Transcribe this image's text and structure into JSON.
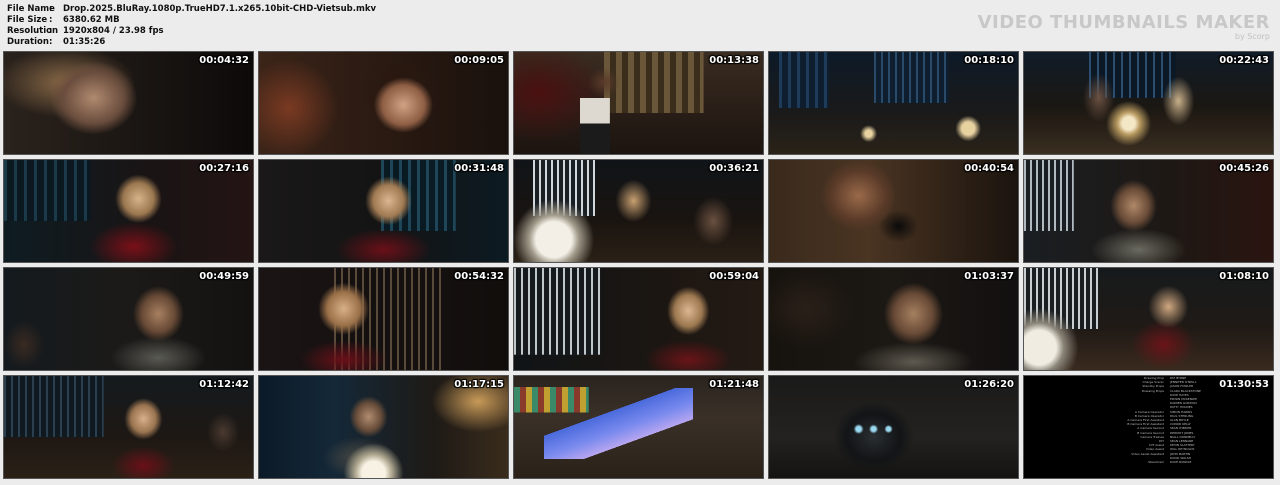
{
  "file_info": [
    {
      "key": "File Name",
      "value": "Drop.2025.BluRay.1080p.TrueHD7.1.x265.10bit-CHD-Vietsub.mkv"
    },
    {
      "key": "File Size",
      "value": "6380.62 MB"
    },
    {
      "key": "Resolution",
      "value": "1920x804 / 23.98 fps"
    },
    {
      "key": "Duration",
      "value": "01:35:26"
    }
  ],
  "separator": ":",
  "brand": {
    "title": "VIDEO THUMBNAILS MAKER",
    "subtitle": "by Scorp"
  },
  "thumbnails": [
    {
      "time": "00:04:32",
      "scene": "closeup-woman-dark"
    },
    {
      "time": "00:09:05",
      "scene": "woman-bangs-warm"
    },
    {
      "time": "00:13:38",
      "scene": "waitress-bar"
    },
    {
      "time": "00:18:10",
      "scene": "restaurant-skyline"
    },
    {
      "time": "00:22:43",
      "scene": "couple-table-night"
    },
    {
      "time": "00:27:16",
      "scene": "blonde-red-dress"
    },
    {
      "time": "00:31:48",
      "scene": "blonde-smiling"
    },
    {
      "time": "00:36:21",
      "scene": "table-lamp-skyline"
    },
    {
      "time": "00:40:54",
      "scene": "hand-phone"
    },
    {
      "time": "00:45:26",
      "scene": "man-dark-hair"
    },
    {
      "time": "00:49:59",
      "scene": "man-beard"
    },
    {
      "time": "00:54:32",
      "scene": "blonde-looking-up"
    },
    {
      "time": "00:59:04",
      "scene": "blonde-window"
    },
    {
      "time": "01:03:37",
      "scene": "man-closeup"
    },
    {
      "time": "01:08:10",
      "scene": "woman-writing"
    },
    {
      "time": "01:12:42",
      "scene": "blonde-restaurant"
    },
    {
      "time": "01:17:15",
      "scene": "older-man-lamp"
    },
    {
      "time": "01:21:48",
      "scene": "phone-screen"
    },
    {
      "time": "01:26:20",
      "scene": "device-lights"
    },
    {
      "time": "01:30:53",
      "scene": "end-credits"
    }
  ]
}
